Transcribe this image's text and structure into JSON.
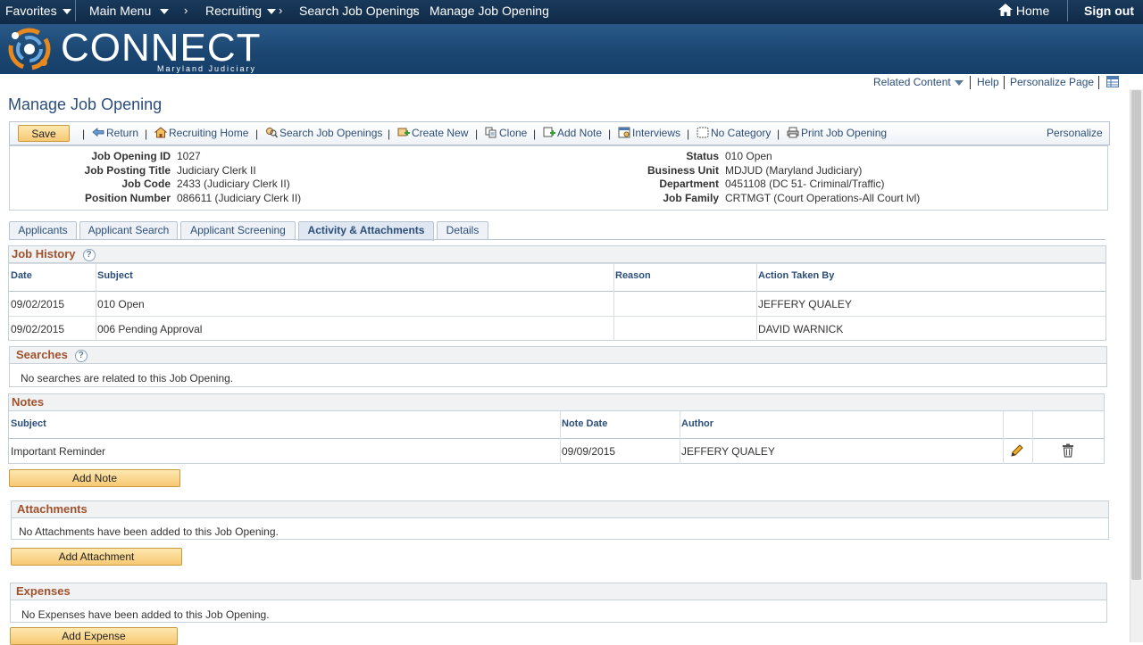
{
  "topnav": {
    "favorites": "Favorites",
    "main_menu": "Main Menu",
    "breadcrumbs": [
      "Recruiting",
      "Search Job Openings",
      "Manage Job Opening"
    ],
    "home": "Home",
    "signout": "Sign out"
  },
  "brand": {
    "name": "CONNECT",
    "sub": "Maryland Judiciary"
  },
  "util": {
    "related": "Related Content",
    "help": "Help",
    "personalize_page": "Personalize Page"
  },
  "page_title": "Manage Job Opening",
  "toolbar": {
    "save": "Save",
    "return": "Return",
    "recruiting_home": "Recruiting Home",
    "search": "Search Job Openings",
    "create_new": "Create New",
    "clone": "Clone",
    "add_note": "Add Note",
    "interviews": "Interviews",
    "no_category": "No Category",
    "print": "Print Job Opening",
    "personalize": "Personalize"
  },
  "info": {
    "job_opening_id": {
      "label": "Job Opening ID",
      "value": "1027"
    },
    "job_posting_title": {
      "label": "Job Posting Title",
      "value": "Judiciary Clerk II"
    },
    "job_code": {
      "label": "Job Code",
      "value": "2433 (Judiciary Clerk II)"
    },
    "position_number": {
      "label": "Position Number",
      "value": "086611 (Judiciary Clerk II)"
    },
    "status": {
      "label": "Status",
      "value": "010 Open"
    },
    "business_unit": {
      "label": "Business Unit",
      "value": "MDJUD (Maryland Judiciary)"
    },
    "department": {
      "label": "Department",
      "value": "0451108 (DC 51- Criminal/Traffic)"
    },
    "job_family": {
      "label": "Job Family",
      "value": "CRTMGT (Court Operations-All Court lvl)"
    }
  },
  "tabs": [
    "Applicants",
    "Applicant Search",
    "Applicant Screening",
    "Activity & Attachments",
    "Details"
  ],
  "job_history": {
    "title": "Job History",
    "columns": [
      "Date",
      "Subject",
      "Reason",
      "Action Taken By"
    ],
    "rows": [
      {
        "date": "09/02/2015",
        "subject": "010 Open",
        "reason": "",
        "by": "JEFFERY QUALEY"
      },
      {
        "date": "09/02/2015",
        "subject": "006 Pending Approval",
        "reason": "",
        "by": "DAVID WARNICK"
      }
    ]
  },
  "searches": {
    "title": "Searches",
    "message": "No searches are related to this Job Opening."
  },
  "notes": {
    "title": "Notes",
    "columns": [
      "Subject",
      "Note Date",
      "Author"
    ],
    "rows": [
      {
        "subject": "Important Reminder",
        "date": "09/09/2015",
        "author": "JEFFERY QUALEY"
      }
    ],
    "add_button": "Add Note"
  },
  "attachments": {
    "title": "Attachments",
    "message": "No Attachments have been added to this Job Opening.",
    "add_button": "Add Attachment"
  },
  "expenses": {
    "title": "Expenses",
    "message": "No Expenses have been added to this Job Opening.",
    "add_button": "Add Expense"
  }
}
